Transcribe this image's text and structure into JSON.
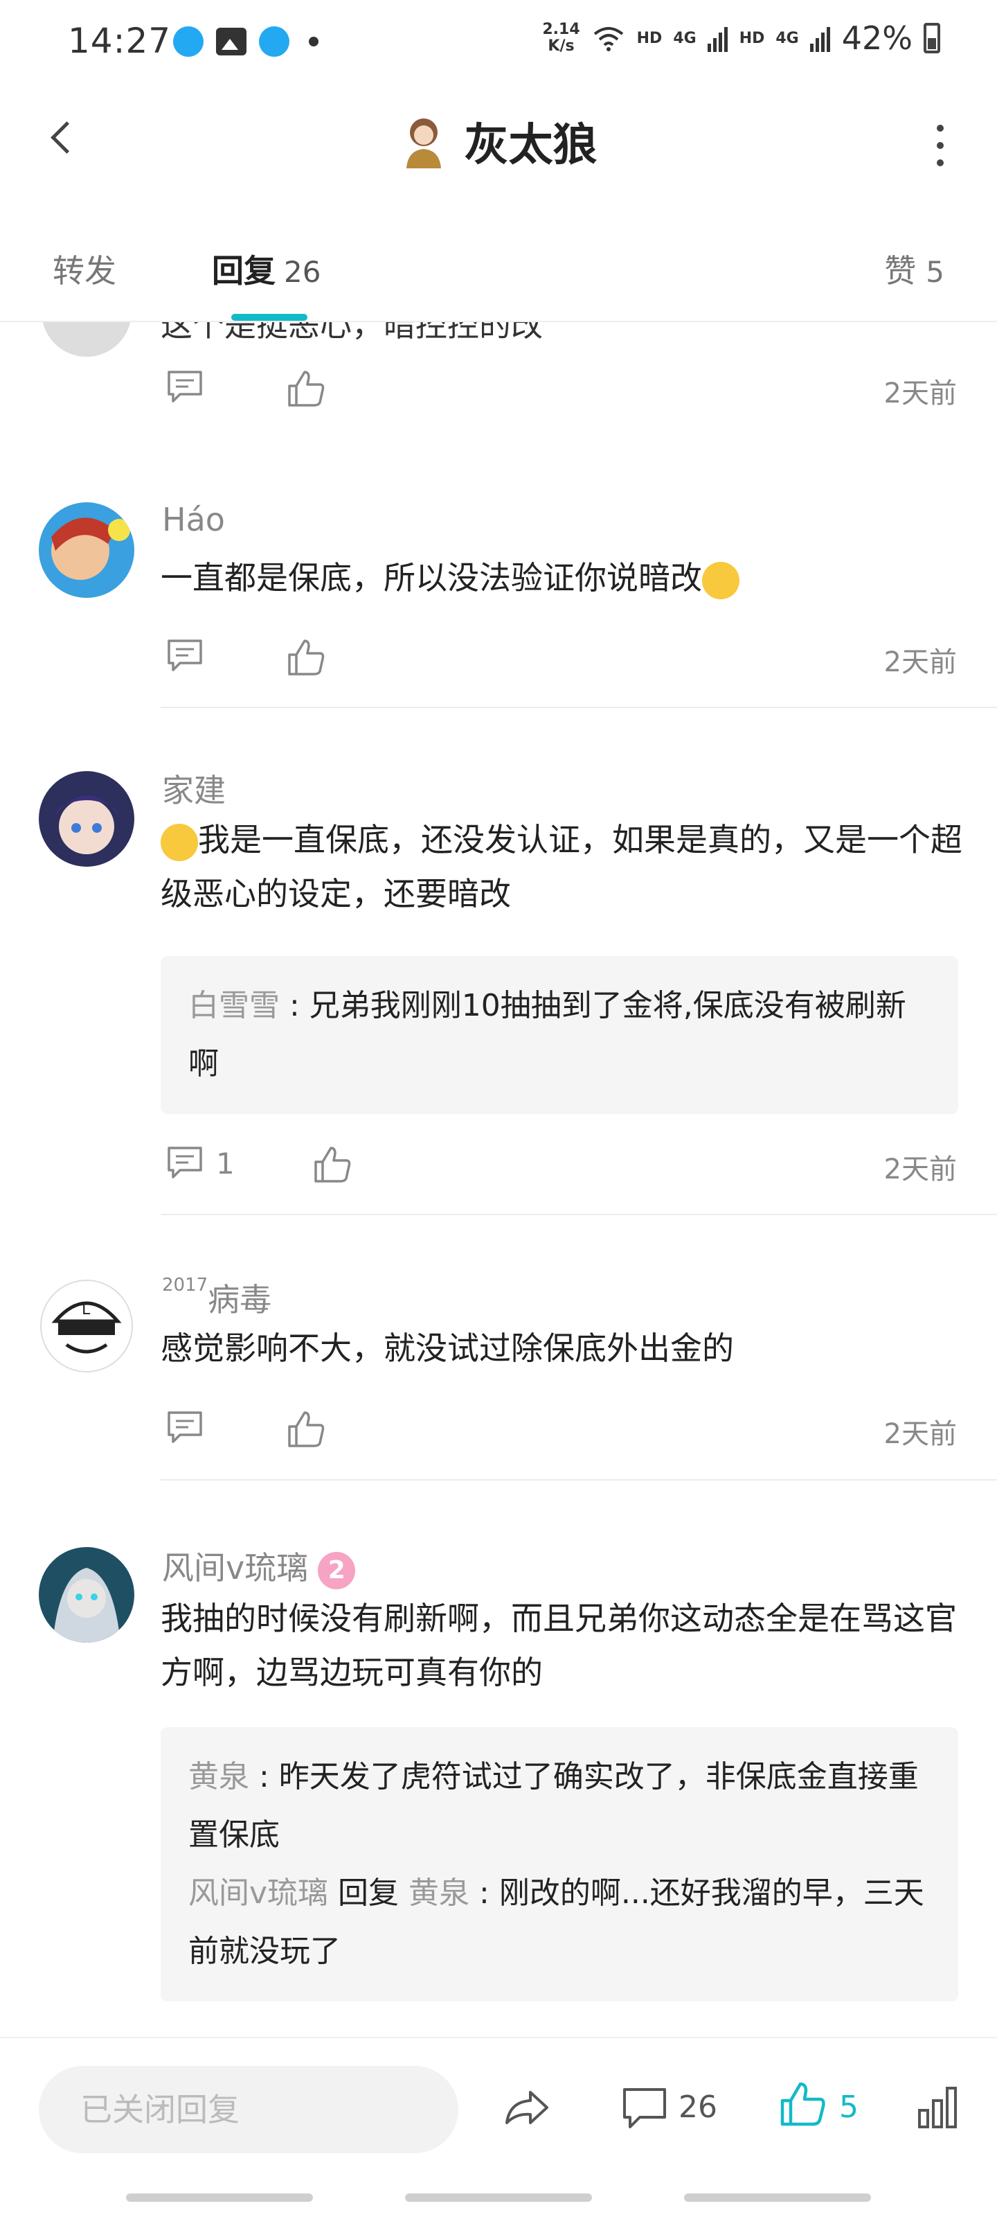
{
  "status_bar": {
    "time": "14:27",
    "net_speed_value": "2.14",
    "net_speed_unit": "K/s",
    "hd1": "HD",
    "lte1": "4G",
    "hd2": "HD",
    "lte2": "4G",
    "battery": "42%"
  },
  "header": {
    "title": "灰太狼"
  },
  "tabs": {
    "forward": "转发",
    "reply": "回复",
    "reply_count": "26",
    "like": "赞",
    "like_count": "5"
  },
  "comments": [
    {
      "partial_text": "这个是挺恶心，暗控控的改",
      "time": "2天前"
    },
    {
      "username": "Háo",
      "text": "一直都是保底，所以没法验证你说暗改",
      "time": "2天前"
    },
    {
      "username": "家建",
      "text": "我是一直保底，还没发认证，如果是真的，又是一个超级恶心的设定，还要暗改",
      "reply_name": "白雪雪",
      "reply_sep": " : ",
      "reply_text": "兄弟我刚刚10抽抽到了金将,保底没有被刷新啊",
      "reply_count": "1",
      "time": "2天前"
    },
    {
      "username_prefix": "2017",
      "username": "病毒",
      "text": "感觉影响不大，就没试过除保底外出金的",
      "time": "2天前"
    },
    {
      "username": "风间v琉璃",
      "level": "2",
      "text": "我抽的时候没有刷新啊，而且兄弟你这动态全是在骂这官方啊，边骂边玩可真有你的",
      "reply1_name": "黄泉",
      "reply1_text": "昨天发了虎符试过了确实改了，非保底金直接重置保底",
      "reply2_name": "风间v琉璃",
      "reply2_mid": "回复",
      "reply2_target": "黄泉",
      "reply2_text": "刚改的啊...还好我溜的早，三天前就没玩了",
      "sep": " : "
    }
  ],
  "bottom_bar": {
    "reply_placeholder": "已关闭回复",
    "comment_count": "26",
    "like_count": "5"
  },
  "colors": {
    "accent": "#14b9c8",
    "muted": "#888888"
  }
}
